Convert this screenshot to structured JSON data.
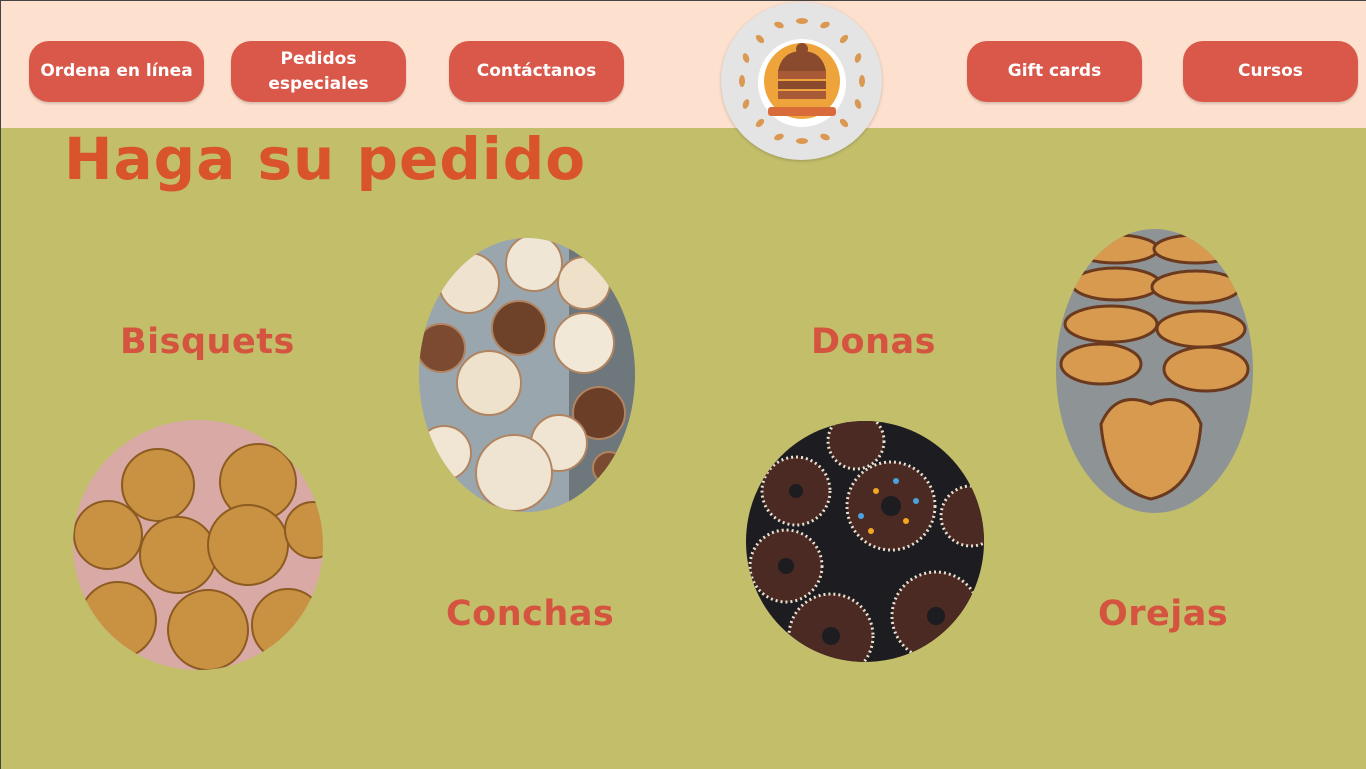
{
  "nav": {
    "ordena_label": "Ordena en línea",
    "pedidos_label": "Pedidos especiales",
    "contacto_label": "Contáctanos",
    "giftcards_label": "Gift cards",
    "cursos_label": "Cursos"
  },
  "logo": {
    "icon": "bakery-logo-icon"
  },
  "main": {
    "title": "Haga su pedido",
    "categories": {
      "bisquets": "Bisquets",
      "conchas": "Conchas",
      "donas": "Donas",
      "orejas": "Orejas"
    }
  },
  "colors": {
    "header_bg": "#fde0ce",
    "page_bg": "#c2be6a",
    "button_bg": "#d9584a",
    "title": "#d9532c",
    "category_label": "#d5543f"
  }
}
